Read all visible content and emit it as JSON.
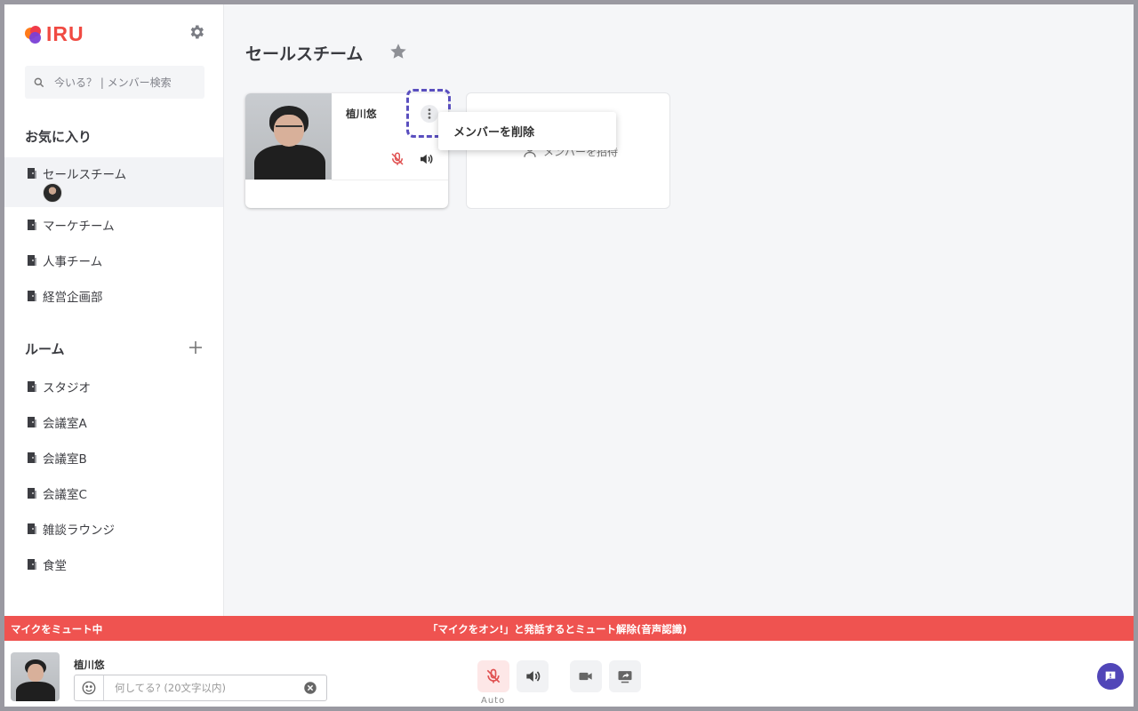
{
  "app": {
    "logo_text": "IRU"
  },
  "sidebar": {
    "search_placeholder": "今いる？ | メンバー検索",
    "favorites_title": "お気に入り",
    "favorites": [
      {
        "label": "セールスチーム"
      },
      {
        "label": "マーケチーム"
      },
      {
        "label": "人事チーム"
      },
      {
        "label": "経営企画部"
      }
    ],
    "rooms_title": "ルーム",
    "rooms": [
      {
        "label": "スタジオ"
      },
      {
        "label": "会議室A"
      },
      {
        "label": "会議室B"
      },
      {
        "label": "会議室C"
      },
      {
        "label": "雑談ラウンジ"
      },
      {
        "label": "食堂"
      }
    ]
  },
  "main": {
    "title": "セールスチーム",
    "member_card": {
      "name": "植川悠"
    },
    "invite_label": "メンバーを招待",
    "context_menu": {
      "remove_member": "メンバーを削除"
    }
  },
  "mute_bar": {
    "left": "マイクをミュート中",
    "center": "「マイクをオン!」と発話するとミュート解除(音声認識)"
  },
  "footer": {
    "name": "植川悠",
    "status_placeholder": "何してる? (20文字以内)",
    "auto_label": "Auto"
  },
  "colors": {
    "accent": "#5146b8",
    "mute_red": "#ef5350",
    "logo_red": "#f04a42"
  }
}
